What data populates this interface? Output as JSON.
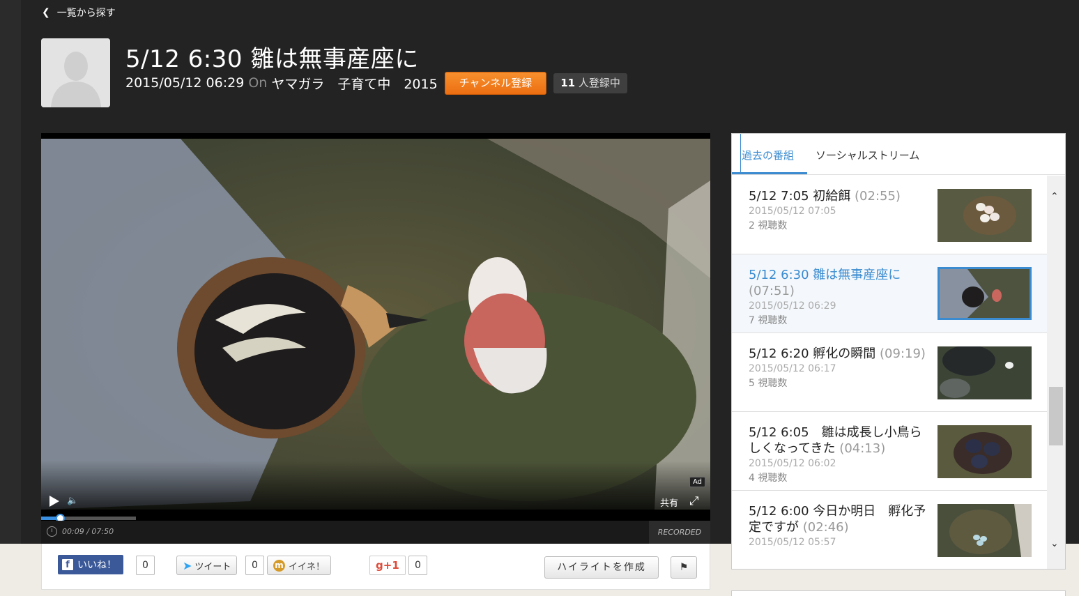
{
  "nav": {
    "back_label": "一覧から探す"
  },
  "header": {
    "title": "5/12 6:30 雛は無事産座に",
    "datetime": "2015/05/12 06:29",
    "on_label": "On",
    "channel": "ヤマガラ　子育て中　2015",
    "subscribe_label": "チャンネル登録",
    "subscribers_count": "11",
    "subscribers_suffix": "人登録中"
  },
  "player": {
    "ad_badge": "Ad",
    "share_label": "共有",
    "time_display": "00:09 / 07:50",
    "recorded_label": "RECORDED LIVE",
    "progress_fraction": 0.02
  },
  "social": {
    "like_label": "いいね！",
    "like_count": "0",
    "tweet_label": "ツイート",
    "tweet_count": "0",
    "mixi_label": "イイネ！",
    "gplus_label": "+1",
    "gplus_count": "0",
    "highlight_label": "ハイライトを作成"
  },
  "sidebar": {
    "tabs": [
      {
        "label": "過去の番組",
        "active": true
      },
      {
        "label": "ソーシャルストリーム",
        "active": false
      }
    ],
    "items": [
      {
        "title": "5/12 7:05 初給餌",
        "duration": "(02:55)",
        "date": "2015/05/12 07:05",
        "views": "2 視聴数",
        "selected": false
      },
      {
        "title": "5/12 6:30 雛は無事産座に",
        "duration": "(07:51)",
        "date": "2015/05/12 06:29",
        "views": "7 視聴数",
        "selected": true
      },
      {
        "title": "5/12 6:20 孵化の瞬間",
        "duration": "(09:19)",
        "date": "2015/05/12 06:17",
        "views": "5 視聴数",
        "selected": false
      },
      {
        "title": "5/12 6:05　雛は成長し小鳥らしくなってきた",
        "duration": "(04:13)",
        "date": "2015/05/12 06:02",
        "views": "4 視聴数",
        "selected": false
      },
      {
        "title": "5/12 6:00 今日か明日　孵化予定ですが",
        "duration": "(02:46)",
        "date": "2015/05/12 05:57",
        "views": "",
        "selected": false
      }
    ]
  },
  "colors": {
    "accent_blue": "#3a8bd0",
    "subscribe_orange": "#f08020",
    "background_dark": "#232323"
  }
}
